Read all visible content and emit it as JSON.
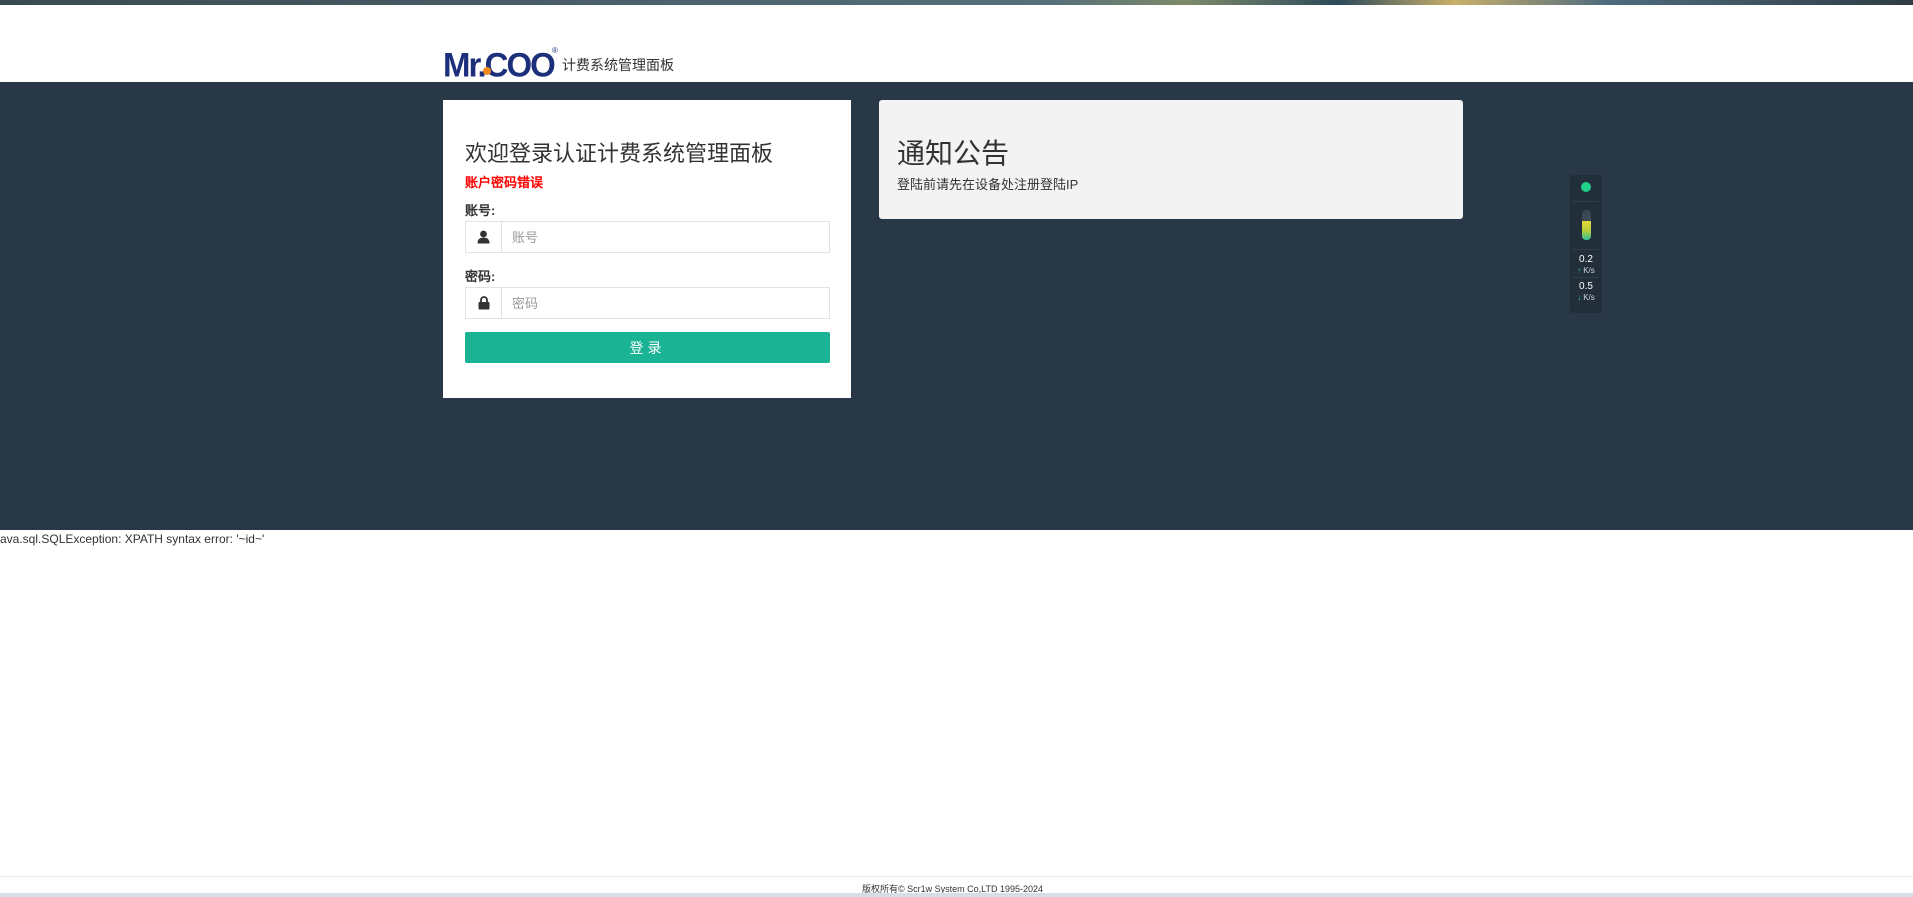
{
  "header": {
    "logo_text": "Mr.COO",
    "logo_registered": "®",
    "subtitle": "计费系统管理面板"
  },
  "login": {
    "title": "欢迎登录认证计费系统管理面板",
    "error": "账户密码错误",
    "username_label": "账号:",
    "username_placeholder": "账号",
    "password_label": "密码:",
    "password_placeholder": "密码",
    "submit_label": "登录",
    "user_icon": "user-icon",
    "lock_icon": "lock-icon"
  },
  "notice": {
    "title": "通知公告",
    "text": "登陆前请先在设备处注册登陆IP"
  },
  "net_widget": {
    "status_color": "#1fd18a",
    "meter_level": 0.62,
    "upload_value": "0.2",
    "upload_unit": "K/s",
    "download_value": "0.5",
    "download_unit": "K/s"
  },
  "error_output": "ava.sql.SQLException: XPATH syntax error: '~id~'",
  "footer": {
    "copyright": "版权所有© Scr1w System Co,LTD 1995-2024"
  },
  "colors": {
    "band": "#293847",
    "accent": "#1ab394",
    "error": "#ff0000",
    "logo_blue": "#1c2f7a",
    "logo_orange": "#f08a1c"
  }
}
